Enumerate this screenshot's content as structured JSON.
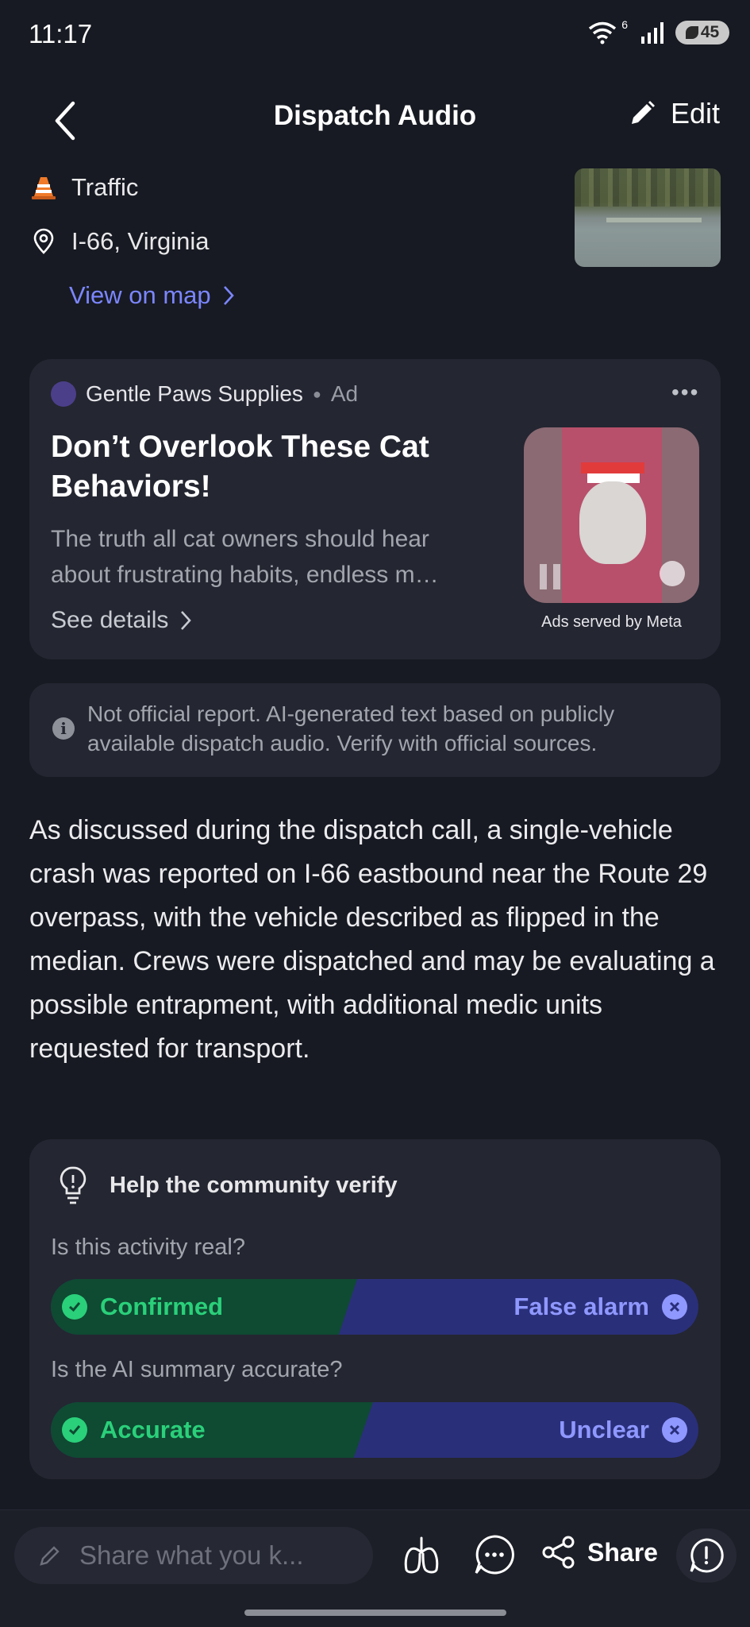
{
  "status_bar": {
    "time": "11:17",
    "network": "6",
    "battery": "45"
  },
  "header": {
    "title": "Dispatch Audio",
    "edit_label": "Edit"
  },
  "incident": {
    "category": "Traffic",
    "category_icon": "traffic-cone-icon",
    "location": "I-66, Virginia",
    "location_icon": "map-pin-icon",
    "view_map_label": "View on map"
  },
  "ad": {
    "advertiser": "Gentle Paws Supplies",
    "ad_label": "Ad",
    "title": "Don’t Overlook These Cat Behaviors!",
    "description": "The truth all cat owners should hear about frustrating habits, endless m…",
    "details_label": "See details",
    "media_caption": "Ads served by Meta"
  },
  "disclaimer": {
    "text": "Not official report. AI-generated text based on publicly available dispatch audio. Verify with official sources."
  },
  "summary": "As discussed during the dispatch call, a single-vehicle crash was reported on I-66 eastbound near the Route 29 overpass, with the vehicle described as flipped in the median. Crews were dispatched and may be evaluating a possible entrapment, with additional medic units requested for transport.",
  "verify": {
    "title": "Help the community verify",
    "q1": {
      "question": "Is this activity real?",
      "yes": "Confirmed",
      "no": "False alarm"
    },
    "q2": {
      "question": "Is the AI summary accurate?",
      "yes": "Accurate",
      "no": "Unclear"
    }
  },
  "bottom_bar": {
    "input_placeholder": "Share what you k...",
    "share_label": "Share"
  },
  "colors": {
    "accent": "#7b86ff",
    "confirm": "#2ad07a",
    "deny": "#8f98ff",
    "background": "#171a22"
  }
}
